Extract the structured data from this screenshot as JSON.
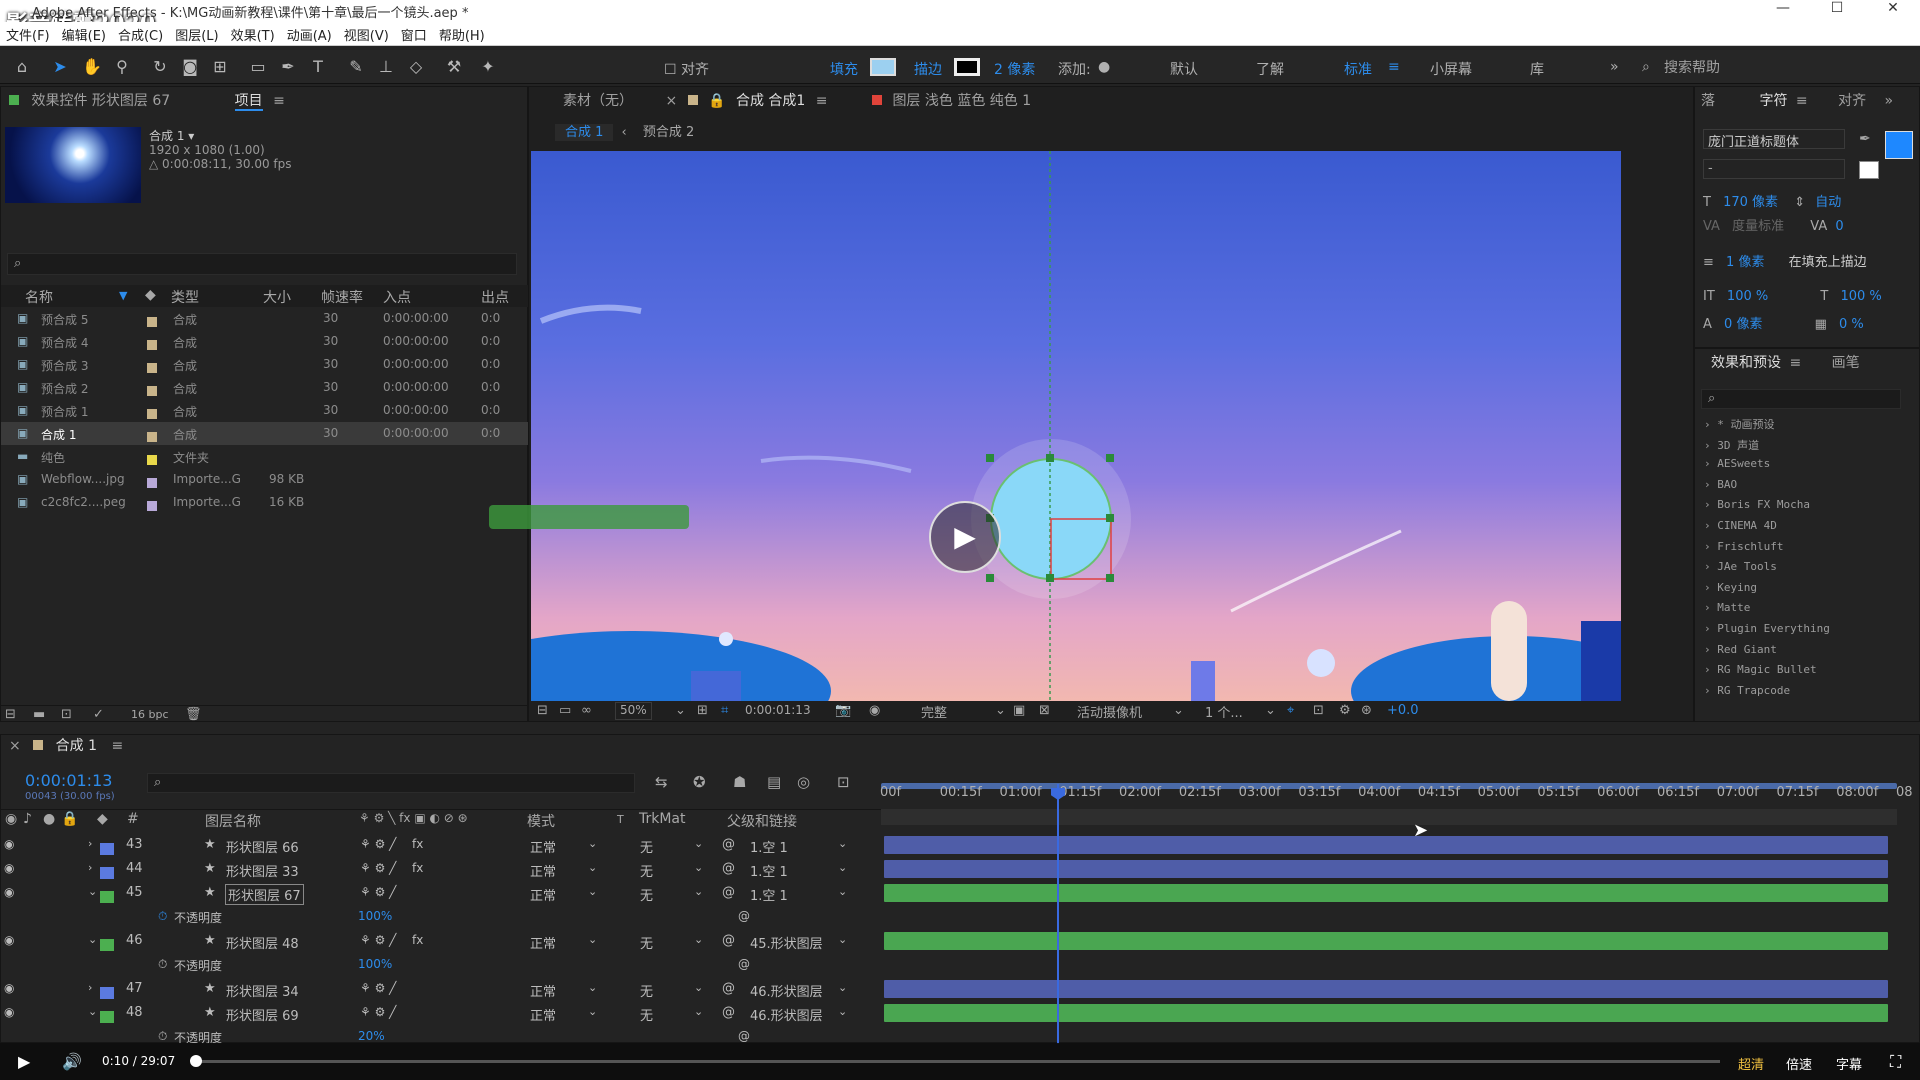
{
  "window": {
    "title": "Adobe After Effects - K:\\MG动画新教程\\课件\\第十章\\最后一个镜头.aep *",
    "watermark": "影音转霸2020",
    "min": "—",
    "max": "☐",
    "close": "✕"
  },
  "menu": [
    "文件(F)",
    "编辑(E)",
    "合成(C)",
    "图层(L)",
    "效果(T)",
    "动画(A)",
    "视图(V)",
    "窗口",
    "帮助(H)"
  ],
  "toolbar": {
    "align": "对齐",
    "fill": "填充",
    "stroke": "描边",
    "stroke_px": "2 像素",
    "add": "添加:",
    "workspaces": [
      "默认",
      "了解",
      "标准",
      "小屏幕",
      "库"
    ],
    "search_placeholder": "搜索帮助"
  },
  "effect_controls": {
    "tab": "效果控件 形状图层 67"
  },
  "project": {
    "tab": "项目",
    "comp_name": "合成 1 ▾",
    "comp_size": "1920 x 1080 (1.00)",
    "comp_duration": "△ 0:00:08:11, 30.00 fps",
    "headers": [
      "名称",
      "类型",
      "大小",
      "帧速率",
      "入点",
      "出点"
    ],
    "items": [
      {
        "name": "预合成 5",
        "type": "合成",
        "size": "",
        "fps": "30",
        "in": "0:00:00:00",
        "out": "0:0",
        "color": "#c9b48a"
      },
      {
        "name": "预合成 4",
        "type": "合成",
        "size": "",
        "fps": "30",
        "in": "0:00:00:00",
        "out": "0:0",
        "color": "#c9b48a"
      },
      {
        "name": "预合成 3",
        "type": "合成",
        "size": "",
        "fps": "30",
        "in": "0:00:00:00",
        "out": "0:0",
        "color": "#c9b48a"
      },
      {
        "name": "预合成 2",
        "type": "合成",
        "size": "",
        "fps": "30",
        "in": "0:00:00:00",
        "out": "0:0",
        "color": "#c9b48a"
      },
      {
        "name": "预合成 1",
        "type": "合成",
        "size": "",
        "fps": "30",
        "in": "0:00:00:00",
        "out": "0:0",
        "color": "#c9b48a"
      },
      {
        "name": "合成 1",
        "type": "合成",
        "size": "",
        "fps": "30",
        "in": "0:00:00:00",
        "out": "0:0",
        "color": "#c9b48a"
      },
      {
        "name": "纯色",
        "type": "文件夹",
        "size": "",
        "fps": "",
        "in": "",
        "out": "",
        "color": "#e8d84a"
      },
      {
        "name": "Webflow....jpg",
        "type": "Importe...G",
        "size": "98 KB",
        "fps": "",
        "in": "",
        "out": "",
        "color": "#b8a9d8"
      },
      {
        "name": "c2c8fc2....peg",
        "type": "Importe...G",
        "size": "16 KB",
        "fps": "",
        "in": "",
        "out": "",
        "color": "#b8a9d8"
      }
    ],
    "bpc": "16 bpc"
  },
  "viewer": {
    "tabs": [
      "素材（无）",
      "合成 合成1",
      "图层 浅色 蓝色 纯色 1"
    ],
    "breadcrumbs": [
      "合成 1",
      "预合成 2"
    ],
    "zoom": "50%",
    "timecode": "0:00:01:13",
    "quality": "完整",
    "camera": "活动摄像机",
    "views": "1 个...",
    "exposure": "+0.0"
  },
  "character": {
    "tabs": [
      "落",
      "字符",
      "对齐"
    ],
    "font": "庞门正道标题体",
    "style": "-",
    "size": "170 像素",
    "leading": "自动",
    "kerning": "度量标准",
    "tracking": "0",
    "stroke_w": "1 像素",
    "stroke_mode": "在填充上描边",
    "vscale": "100 %",
    "hscale": "100 %",
    "baseline": "0 像素",
    "tsume": "0 %"
  },
  "effects": {
    "tabs": [
      "效果和预设",
      "画笔"
    ],
    "items": [
      "* 动画预设",
      "3D 声道",
      "AESweets",
      "BAO",
      "Boris FX Mocha",
      "CINEMA 4D",
      "Frischluft",
      "JAe Tools",
      "Keying",
      "Matte",
      "Plugin Everything",
      "Red Giant",
      "RG Magic Bullet",
      "RG Trapcode"
    ]
  },
  "timeline": {
    "tab": "合成 1",
    "timecode": "0:00:01:13",
    "frame_info": "00043 (30.00 fps)",
    "headers": {
      "layer_name": "图层名称",
      "mode": "模式",
      "t": "T",
      "trkmat": "TrkMat",
      "parent": "父级和链接"
    },
    "ruler": [
      "00f",
      "00:15f",
      "01:00f",
      "01:15f",
      "02:00f",
      "02:15f",
      "03:00f",
      "03:15f",
      "04:00f",
      "04:15f",
      "05:00f",
      "05:15f",
      "06:00f",
      "06:15f",
      "07:00f",
      "07:15f",
      "08:00f",
      "08"
    ],
    "layers": [
      {
        "num": "43",
        "name": "形状图层 66",
        "mode": "正常",
        "trk": "无",
        "parent": "1.空 1",
        "color": "#5b7ae0",
        "bar": "#4f5da8",
        "fx": "fx"
      },
      {
        "num": "44",
        "name": "形状图层 33",
        "mode": "正常",
        "trk": "无",
        "parent": "1.空 1",
        "color": "#5b7ae0",
        "bar": "#4f5da8",
        "fx": "fx"
      },
      {
        "num": "45",
        "name": "形状图层 67",
        "mode": "正常",
        "trk": "无",
        "parent": "1.空 1",
        "color": "#4caf50",
        "bar": "#4aa651",
        "fx": ""
      },
      {
        "num": "46",
        "name": "形状图层 48",
        "mode": "正常",
        "trk": "无",
        "parent": "45.形状图层",
        "color": "#4caf50",
        "bar": "#4aa651",
        "fx": "fx"
      },
      {
        "num": "47",
        "name": "形状图层 34",
        "mode": "正常",
        "trk": "无",
        "parent": "46.形状图层",
        "color": "#5b7ae0",
        "bar": "#4f5da8",
        "fx": ""
      },
      {
        "num": "48",
        "name": "形状图层 69",
        "mode": "正常",
        "trk": "无",
        "parent": "46.形状图层",
        "color": "#4caf50",
        "bar": "#4aa651",
        "fx": ""
      }
    ],
    "opacity_label": "不透明度",
    "opacity_values": [
      "100%",
      "100%",
      "20%"
    ]
  },
  "player": {
    "time": "0:10 / 29:07",
    "hd": "超清",
    "speed": "倍速",
    "subtitle": "字幕"
  }
}
